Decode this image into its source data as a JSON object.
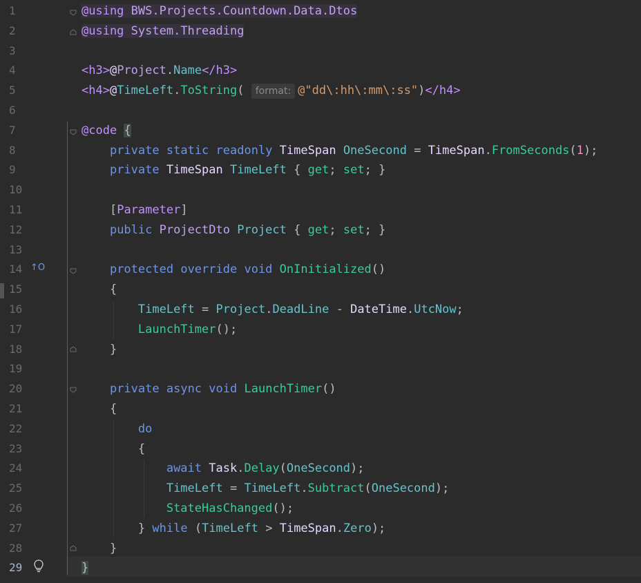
{
  "editor": {
    "current_line": 29,
    "hint_label": "format:",
    "override_marker": "↑O"
  },
  "lines": [
    {
      "n": "1"
    },
    {
      "n": "2"
    },
    {
      "n": "3"
    },
    {
      "n": "4"
    },
    {
      "n": "5"
    },
    {
      "n": "6"
    },
    {
      "n": "7"
    },
    {
      "n": "8"
    },
    {
      "n": "9"
    },
    {
      "n": "10"
    },
    {
      "n": "11"
    },
    {
      "n": "12"
    },
    {
      "n": "13"
    },
    {
      "n": "14"
    },
    {
      "n": "15"
    },
    {
      "n": "16"
    },
    {
      "n": "17"
    },
    {
      "n": "18"
    },
    {
      "n": "19"
    },
    {
      "n": "20"
    },
    {
      "n": "21"
    },
    {
      "n": "22"
    },
    {
      "n": "23"
    },
    {
      "n": "24"
    },
    {
      "n": "25"
    },
    {
      "n": "26"
    },
    {
      "n": "27"
    },
    {
      "n": "28"
    },
    {
      "n": "29"
    }
  ],
  "code": {
    "l1": {
      "at": "@using",
      "ns": "BWS.Projects.Countdown.Data.Dtos"
    },
    "l2": {
      "at": "@using",
      "ns": "System.Threading"
    },
    "l4": {
      "open": "<h3>",
      "at": "@",
      "obj": "Project",
      "dot": ".",
      "prop": "Name",
      "close": "</h3>"
    },
    "l5": {
      "open": "<h4>",
      "at": "@",
      "obj": "TimeLeft",
      "dot": ".",
      "meth": "ToString",
      "paren": "(",
      "str": "@\"dd\\:hh\\:mm\\:ss\"",
      "cparen": ")",
      "close": "</h4>"
    },
    "l7": {
      "at": "@code",
      "brace": "{"
    },
    "l8": {
      "kw1": "private",
      "kw2": "static",
      "kw3": "readonly",
      "type": "TimeSpan",
      "name": "OneSecond",
      "eq": "=",
      "type2": "TimeSpan",
      "dot": ".",
      "meth": "FromSeconds",
      "po": "(",
      "num": "1",
      "pc": ");"
    },
    "l9": {
      "kw": "private",
      "type": "TimeSpan",
      "name": "TimeLeft",
      "ob": "{",
      "get": "get",
      "semi1": ";",
      "set": "set",
      "semi2": ";",
      "cb": "}"
    },
    "l11": {
      "ob": "[",
      "attr": "Parameter",
      "cb": "]"
    },
    "l12": {
      "kw": "public",
      "type": "ProjectDto",
      "name": "Project",
      "ob": "{",
      "get": "get",
      "semi1": ";",
      "set": "set",
      "semi2": ";",
      "cb": "}"
    },
    "l14": {
      "kw1": "protected",
      "kw2": "override",
      "kw3": "void",
      "meth": "OnInitialized",
      "paren": "()"
    },
    "l15": {
      "brace": "{"
    },
    "l16": {
      "prop": "TimeLeft",
      "eq": "=",
      "obj": "Project",
      "dot": ".",
      "prop2": "DeadLine",
      "minus": "-",
      "type": "DateTime",
      "dot2": ".",
      "prop3": "UtcNow",
      "semi": ";"
    },
    "l17": {
      "meth": "LaunchTimer",
      "paren": "();"
    },
    "l18": {
      "brace": "}"
    },
    "l20": {
      "kw1": "private",
      "kw2": "async",
      "kw3": "void",
      "meth": "LaunchTimer",
      "paren": "()"
    },
    "l21": {
      "brace": "{"
    },
    "l22": {
      "kw": "do"
    },
    "l23": {
      "brace": "{"
    },
    "l24": {
      "kw": "await",
      "type": "Task",
      "dot": ".",
      "meth": "Delay",
      "po": "(",
      "arg": "OneSecond",
      "pc": ");"
    },
    "l25": {
      "prop": "TimeLeft",
      "eq": "=",
      "prop2": "TimeLeft",
      "dot": ".",
      "meth": "Subtract",
      "po": "(",
      "arg": "OneSecond",
      "pc": ");"
    },
    "l26": {
      "meth": "StateHasChanged",
      "paren": "();"
    },
    "l27": {
      "cb": "}",
      "kw": "while",
      "po": "(",
      "prop": "TimeLeft",
      "gt": ">",
      "type": "TimeSpan",
      "dot": ".",
      "prop2": "Zero",
      "pc": ");"
    },
    "l28": {
      "brace": "}"
    },
    "l29": {
      "brace": "}"
    }
  }
}
